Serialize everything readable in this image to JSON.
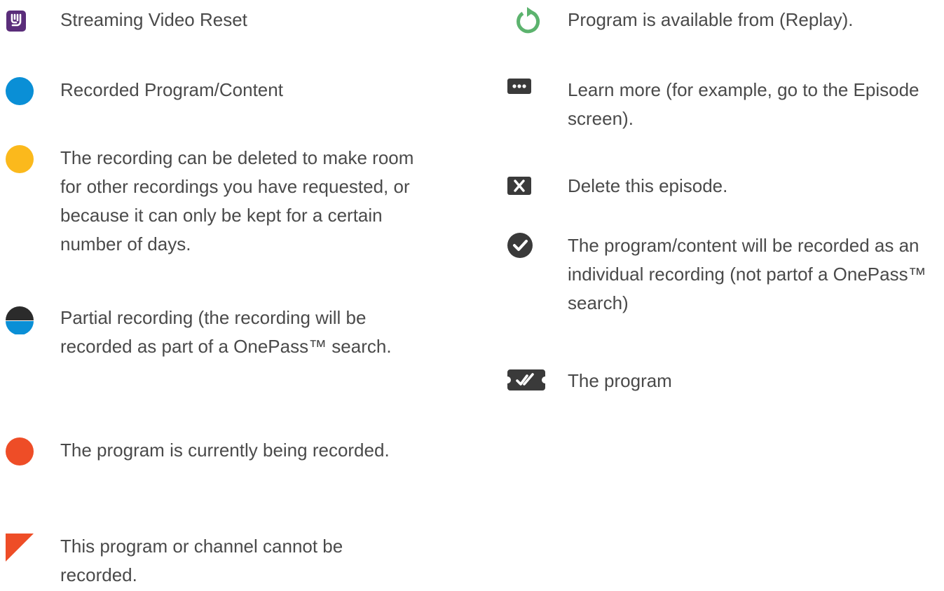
{
  "legend": {
    "left": [
      {
        "icon": "streaming-video-reset-icon",
        "text": "Streaming Video Reset"
      },
      {
        "icon": "recorded-blue-dot-icon",
        "text": "Recorded Program/Content"
      },
      {
        "icon": "yellow-dot-icon",
        "text": "The recording can be deleted to make room for other recordings you have requested, or because it can only be kept for a certain number of days."
      },
      {
        "icon": "partial-recording-dot-icon",
        "text": "Partial recording (the recording will be recorded as part of a OnePass™ search."
      },
      {
        "icon": "red-dot-icon",
        "text": "The program is currently being recorded."
      },
      {
        "icon": "red-corner-triangle-icon",
        "text": "This program or channel cannot be recorded."
      }
    ],
    "right": [
      {
        "icon": "replay-arrow-icon",
        "text": "Program is available from (Replay)."
      },
      {
        "icon": "more-dots-icon",
        "text": "Learn more (for example, go to the Episode screen)."
      },
      {
        "icon": "delete-x-icon",
        "text": "Delete this episode."
      },
      {
        "icon": "check-circle-icon",
        "text": "The program/content will be recorded as an individual recording (not partof a OnePass™ search)"
      },
      {
        "icon": "double-check-ticket-icon",
        "text": "The program"
      }
    ]
  },
  "colors": {
    "text": "#4a4a4a",
    "blue": "#0a8fd6",
    "yellow": "#fbb91c",
    "red": "#ee4d27",
    "dark": "#2b2b2b",
    "green": "#5cb36e",
    "icon_dark": "#3a3a3a",
    "purple": "#5a2d7a"
  }
}
